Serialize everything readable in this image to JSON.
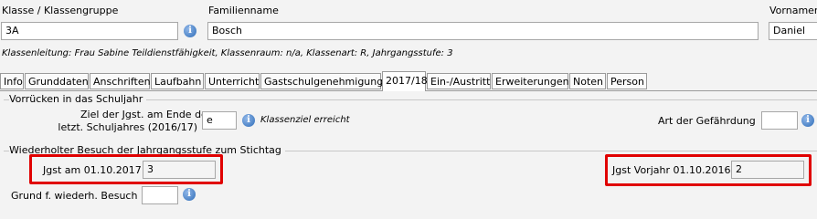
{
  "header": {
    "klasse_label": "Klasse / Klassengruppe",
    "familienname_label": "Familienname",
    "vorname_label": "Vornamen",
    "klasse_value": "3A",
    "familienname_value": "Bosch",
    "vorname_value": "Daniel",
    "klassenleitung_text": "Klassenleitung: Frau Sabine Teildienstfähigkeit, Klassenraum: n/a, Klassenart: R, Jahrgangsstufe: 3"
  },
  "tabs": [
    {
      "label": "Info"
    },
    {
      "label": "Grunddaten"
    },
    {
      "label": "Anschriften"
    },
    {
      "label": "Laufbahn"
    },
    {
      "label": "Unterricht"
    },
    {
      "label": "Gastschulgenehmigung"
    },
    {
      "label": "2017/18",
      "active": true
    },
    {
      "label": "Ein-/Austritt"
    },
    {
      "label": "Erweiterungen"
    },
    {
      "label": "Noten"
    },
    {
      "label": "Person"
    }
  ],
  "vorruecken": {
    "title": "Vorrücken in das Schuljahr",
    "ziel_label_line1": "Ziel der Jgst. am Ende des",
    "ziel_label_line2": "letzt. Schuljahres (2016/17)",
    "ziel_value": "e",
    "ziel_hint": "Klassenziel erreicht",
    "gefaehrdung_label": "Art der Gefährdung",
    "gefaehrdung_value": ""
  },
  "wiederholt": {
    "title": "Wiederholter Besuch der Jahrgangsstufe zum Stichtag",
    "jgst_label": "Jgst am 01.10.2017",
    "jgst_value": "3",
    "vorjahr_label": "Jgst Vorjahr 01.10.2016",
    "vorjahr_value": "2",
    "grund_label": "Grund f. wiederh. Besuch",
    "grund_value": ""
  },
  "colors": {
    "highlight": "#e00000",
    "info_icon": "#2f6db8"
  }
}
